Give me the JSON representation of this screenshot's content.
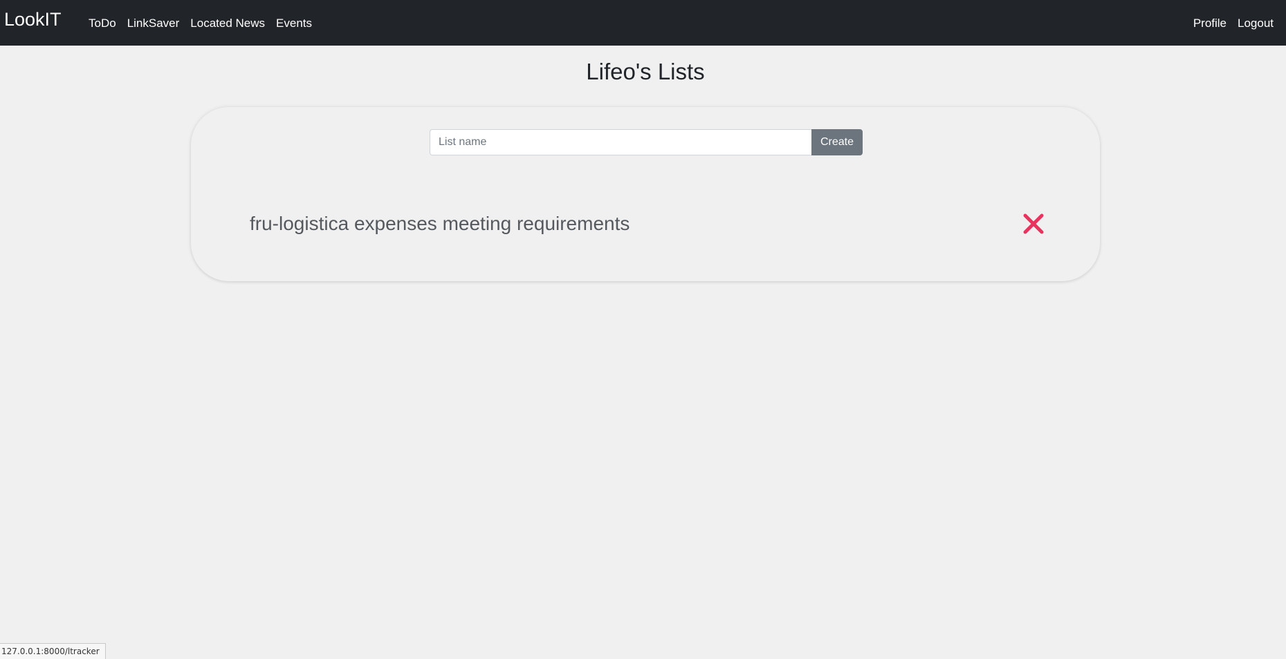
{
  "navbar": {
    "brand": "LookIT",
    "links": [
      {
        "label": "ToDo"
      },
      {
        "label": "LinkSaver"
      },
      {
        "label": "Located News"
      },
      {
        "label": "Events"
      }
    ],
    "right_links": [
      {
        "label": "Profile"
      },
      {
        "label": "Logout"
      }
    ],
    "background_color": "#212529"
  },
  "main": {
    "title": "Lifeo's Lists",
    "create_form": {
      "input_value": "",
      "input_placeholder": "List name",
      "button_label": "Create"
    },
    "lists": [
      {
        "name": "fru-logistica expenses meeting requirements",
        "delete_icon": "close-icon"
      }
    ],
    "delete_color": "#e8335f"
  },
  "status_bar": {
    "url": "127.0.0.1:8000/ltracker"
  }
}
